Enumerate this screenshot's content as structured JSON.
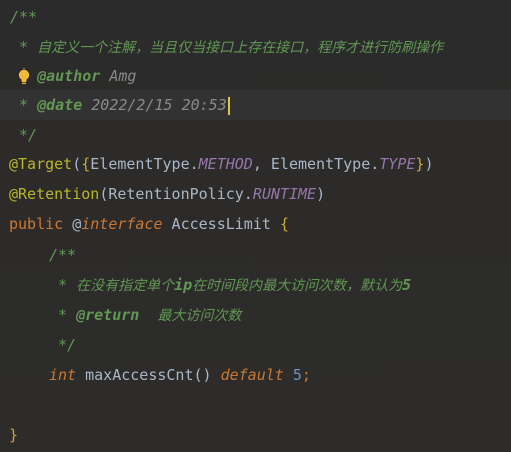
{
  "editor": {
    "lines": [
      {
        "id": "l1",
        "parts": [
          {
            "t": "/**",
            "c": "doc"
          }
        ]
      },
      {
        "id": "l2",
        "parts": [
          {
            "t": " * ",
            "c": "doc"
          },
          {
            "t": "自定义一个注解，当且仅当接口上存在接口，程序才进行防刷操作",
            "c": "doc-cn"
          }
        ]
      },
      {
        "id": "l3",
        "parts": [
          {
            "t": " * ",
            "c": "doc"
          },
          {
            "t": "@author",
            "c": "doctag"
          },
          {
            "t": " Amg",
            "c": "docval"
          }
        ]
      },
      {
        "id": "l4",
        "parts": [
          {
            "t": " * ",
            "c": "doc"
          },
          {
            "t": "@date",
            "c": "doctag"
          },
          {
            "t": " 2022/2/15 20:53",
            "c": "docval"
          }
        ]
      },
      {
        "id": "l5",
        "parts": [
          {
            "t": " */",
            "c": "doc"
          }
        ]
      },
      {
        "id": "l6",
        "parts": [
          {
            "t": "@Target",
            "c": "anno"
          },
          {
            "t": "(",
            "c": "plain"
          },
          {
            "t": "{",
            "c": "brace-y"
          },
          {
            "t": "ElementType.",
            "c": "plain"
          },
          {
            "t": "METHOD",
            "c": "field"
          },
          {
            "t": ", ElementType.",
            "c": "plain"
          },
          {
            "t": "TYPE",
            "c": "field"
          },
          {
            "t": "}",
            "c": "brace-y"
          },
          {
            "t": ")",
            "c": "plain"
          }
        ]
      },
      {
        "id": "l7",
        "parts": [
          {
            "t": "@Retention",
            "c": "anno"
          },
          {
            "t": "(RetentionPolicy.",
            "c": "plain"
          },
          {
            "t": "RUNTIME",
            "c": "field"
          },
          {
            "t": ")",
            "c": "plain"
          }
        ]
      },
      {
        "id": "l8",
        "parts": [
          {
            "t": "public ",
            "c": "kw"
          },
          {
            "t": "@",
            "c": "plain"
          },
          {
            "t": "interface",
            "c": "kwi"
          },
          {
            "t": " AccessLimit ",
            "c": "plain"
          },
          {
            "t": "{",
            "c": "brace-y"
          }
        ]
      },
      {
        "id": "l9",
        "parts": [
          {
            "t": "/**",
            "c": "doc"
          }
        ]
      },
      {
        "id": "l10",
        "parts": [
          {
            "t": " * ",
            "c": "doc"
          },
          {
            "t": "在没有指定单个",
            "c": "doc-cn"
          },
          {
            "t": "ip",
            "c": "doctag"
          },
          {
            "t": "在时间段内最大访问次数，默认为",
            "c": "doc-cn"
          },
          {
            "t": "5",
            "c": "doctag"
          }
        ]
      },
      {
        "id": "l11",
        "parts": [
          {
            "t": " * ",
            "c": "doc"
          },
          {
            "t": "@return",
            "c": "doctag"
          },
          {
            "t": "  ",
            "c": "doc"
          },
          {
            "t": "最大访问次数",
            "c": "doc-cn"
          }
        ]
      },
      {
        "id": "l12",
        "parts": [
          {
            "t": " */",
            "c": "doc"
          }
        ]
      },
      {
        "id": "l13",
        "parts": [
          {
            "t": "int ",
            "c": "kwi"
          },
          {
            "t": "maxAccessCnt() ",
            "c": "plain"
          },
          {
            "t": "default ",
            "c": "kwi"
          },
          {
            "t": "5",
            "c": "num"
          },
          {
            "t": ";",
            "c": "kw"
          }
        ]
      },
      {
        "id": "l14",
        "parts": []
      },
      {
        "id": "l15",
        "parts": [
          {
            "t": "}",
            "c": "brace-y"
          }
        ]
      }
    ]
  },
  "colors": {
    "background": "#2b2b2b",
    "doc_comment": "#629755",
    "annotation": "#bbb529",
    "keyword": "#cc7832",
    "field": "#9876aa",
    "number": "#6897bb",
    "caret": "#e0c341"
  },
  "icons": {
    "gutter": "intention-bulb-icon"
  }
}
